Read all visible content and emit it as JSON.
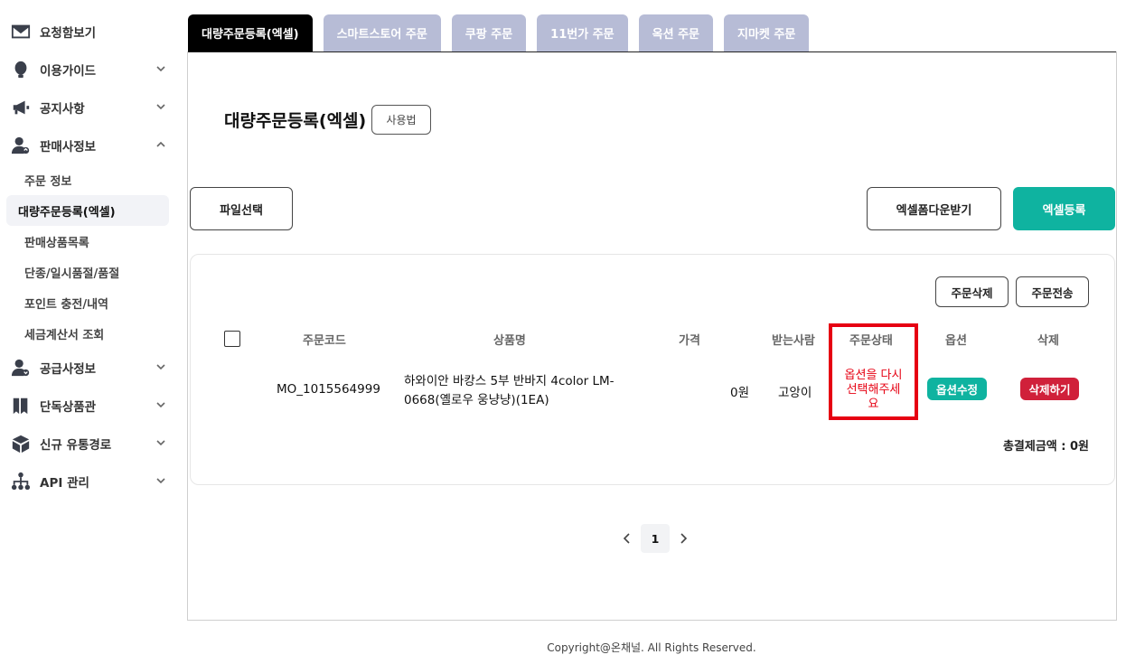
{
  "sidebar": {
    "items": [
      {
        "label": "요청함보기",
        "icon": "envelope-icon",
        "chevron": "none"
      },
      {
        "label": "이용가이드",
        "icon": "bulb-icon",
        "chevron": "down"
      },
      {
        "label": "공지사항",
        "icon": "megaphone-icon",
        "chevron": "down"
      },
      {
        "label": "판매사정보",
        "icon": "seller-icon",
        "chevron": "up"
      },
      {
        "label": "공급사정보",
        "icon": "supplier-icon",
        "chevron": "down"
      },
      {
        "label": "단독상품관",
        "icon": "bookmark-icon",
        "chevron": "down"
      },
      {
        "label": "신규 유통경로",
        "icon": "box-icon",
        "chevron": "down"
      },
      {
        "label": "API 관리",
        "icon": "network-icon",
        "chevron": "down"
      }
    ],
    "sub_items": [
      {
        "label": "주문 정보"
      },
      {
        "label": "대량주문등록(엑셀)",
        "active": true
      },
      {
        "label": "판매상품목록"
      },
      {
        "label": "단종/일시품절/품절"
      },
      {
        "label": "포인트 충전/내역"
      },
      {
        "label": "세금계산서 조회"
      }
    ]
  },
  "tabs": [
    {
      "label": "대량주문등록(엑셀)",
      "active": true
    },
    {
      "label": "스마트스토어 주문"
    },
    {
      "label": "쿠팡 주문"
    },
    {
      "label": "11번가 주문"
    },
    {
      "label": "옥션 주문"
    },
    {
      "label": "지마켓 주문"
    }
  ],
  "page": {
    "title": "대량주문등록(엑셀)",
    "howto_label": "사용법",
    "file_select_label": "파일선택",
    "form_download_label": "엑셀폼다운받기",
    "excel_register_label": "엑셀등록"
  },
  "panel": {
    "delete_order_label": "주문삭제",
    "send_order_label": "주문전송",
    "columns": [
      "주문코드",
      "상품명",
      "가격",
      "받는사람",
      "주문상태",
      "옵션",
      "삭제"
    ],
    "row": {
      "order_code": "MO_1015564999",
      "product_line1": "하와이안 바캉스 5부 반바지 4color LM-",
      "product_line2": "0668(옐로우 웅냥냥)(1EA)",
      "price": "0원",
      "recipient": "고앙이",
      "status_line1": "옵션을 다시",
      "status_line2": "선택해주세",
      "status_line3": "요",
      "option_btn": "옵션수정",
      "delete_btn": "삭제하기"
    },
    "total": "총결제금액 : 0원"
  },
  "pagination": {
    "current": "1"
  },
  "footer": "Copyright@온채널. All Rights Reserved.",
  "colors": {
    "accent": "#0fb3a0",
    "danger": "#d0203a",
    "tab_inactive": "#b7bcd6",
    "highlight": "#e60012"
  }
}
